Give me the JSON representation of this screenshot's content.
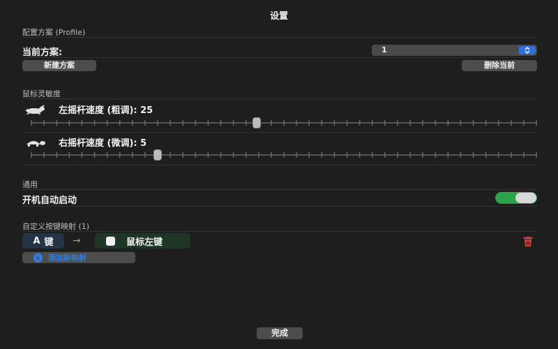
{
  "window": {
    "title": "设置"
  },
  "profile": {
    "section_label": "配置方案 (Profile)",
    "current_label": "当前方案:",
    "current_value": "1",
    "new_button": "新建方案",
    "delete_button": "删除当前"
  },
  "mouse": {
    "section_label": "鼠标灵敏度",
    "left_stick": {
      "label": "左摇杆速度 (粗调): 25",
      "value": 25,
      "icon": "hare-icon"
    },
    "right_stick": {
      "label": "右摇杆速度 (微调): 5",
      "value": 5,
      "icon": "tortoise-icon"
    }
  },
  "general": {
    "section_label": "通用",
    "autostart_label": "开机自动启动",
    "autostart_on": true
  },
  "mapping": {
    "section_label": "自定义按键映射 (1)",
    "items": [
      {
        "key": "A",
        "key_label": "键",
        "target": "鼠标左键"
      }
    ],
    "add_button": "添加新映射",
    "accent_color": "#2f7ee8",
    "delete_color": "#e0413a"
  },
  "footer": {
    "done_button": "完成"
  }
}
